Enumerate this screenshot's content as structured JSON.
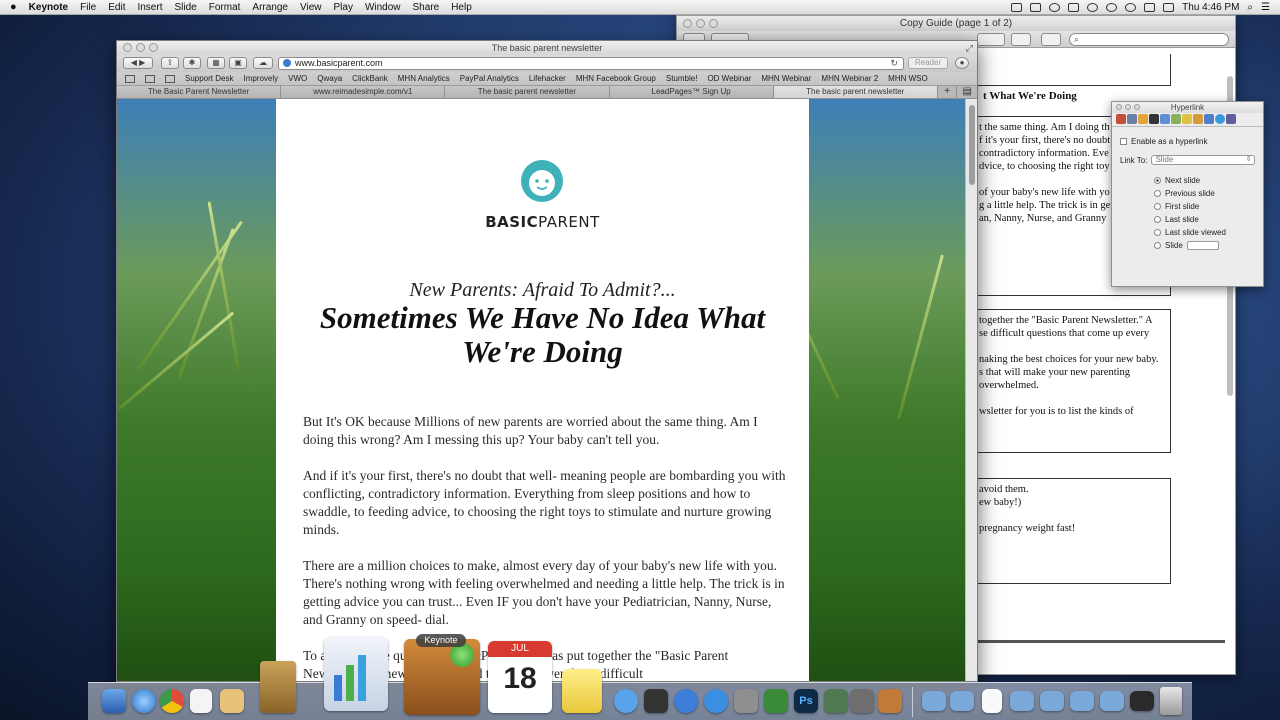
{
  "menubar": {
    "apple": "",
    "app_name": "Keynote",
    "items": [
      "File",
      "Edit",
      "Insert",
      "Slide",
      "Format",
      "Arrange",
      "View",
      "Play",
      "Window",
      "Share",
      "Help"
    ],
    "clock": "Thu 4:46 PM",
    "search_glyph": "⌕",
    "list_glyph": "☰"
  },
  "copy_guide": {
    "title": "Copy Guide (page 1 of 2)",
    "search_placeholder": "",
    "heading_fragment": "t What We're Doing",
    "box1_lines": [
      "t the same thing. Am I doing th",
      "f it's your first, there's no doubt",
      "contradictory information. Eve",
      "dvice, to choosing the right toy",
      "",
      "of your baby's new life with yo",
      "g a little help. The trick is in get",
      "an, Nanny, Nurse, and Granny"
    ],
    "box2_lines": [
      "together the \"Basic Parent Newsletter.\" A",
      "se difficult questions that come up every",
      "",
      "naking the best choices for your new baby.",
      "s that will make your new parenting",
      "overwhelmed.",
      "",
      "wsletter for you is to list the kinds of"
    ],
    "box3_lines": [
      "avoid them.",
      "ew baby!)",
      "",
      " pregnancy weight fast!"
    ]
  },
  "hyperlink": {
    "title": "Hyperlink",
    "enable_label": "Enable as a hyperlink",
    "link_to_label": "Link To:",
    "link_to_value": "Slide",
    "options": [
      "Next slide",
      "Previous slide",
      "First slide",
      "Last slide",
      "Last slide viewed",
      "Slide"
    ],
    "selected_option": 0
  },
  "safari": {
    "title": "The basic parent newsletter",
    "url": "www.basicparent.com",
    "reader_label": "Reader",
    "bookmarks": [
      "Support Desk",
      "Improvely",
      "VWO",
      "Qwaya",
      "ClickBank",
      "MHN Analytics",
      "PayPal Analytics",
      "Lifehacker",
      "MHN Facebook Group",
      "Stumble!",
      "OD Webinar",
      "MHN Webinar",
      "MHN Webinar 2",
      "MHN WSO"
    ],
    "tabs": [
      {
        "label": "The Basic Parent Newsletter",
        "active": false
      },
      {
        "label": "www.reimadesimple.com/v1",
        "active": false
      },
      {
        "label": "The basic parent newsletter",
        "active": false
      },
      {
        "label": "LeadPages™ Sign Up",
        "active": false
      },
      {
        "label": "The basic parent newsletter",
        "active": true
      }
    ],
    "new_tab": "+"
  },
  "page": {
    "brand_bold": "BASIC",
    "brand_light": "PARENT",
    "kicker": "New Parents: Afraid To Admit?...",
    "headline": "Sometimes We Have No Idea What We're Doing",
    "paragraphs": [
      "But It's OK because Millions of new parents are worried about the same thing. Am I doing this wrong? Am I messing this up? Your baby can't tell you.",
      "And if it's your first, there's no doubt that well- meaning people are bombarding you with conflicting, contradictory information. Everything from sleep positions and how to swaddle, to feeding advice, to choosing the right toys to stimulate and nurture growing minds.",
      "There are a million choices to make, almost every day of your baby's new life with you. There's nothing wrong with feeling overwhelmed and needing a little help. The trick is in getting advice you can trust... Even IF you don't have your Pediatrician, Nanny, Nurse, and Granny on speed- dial.",
      "To answer these questions, BasicParent.com has put together the \"Basic Parent Newsletter.\" A newsletter created to help answer those difficult"
    ]
  },
  "dock": {
    "tooltip": "Keynote",
    "calendar_month": "JUL",
    "calendar_day": "18",
    "photoshop_label": "Ps"
  },
  "colors": {
    "brand_teal": "#3fb1b8",
    "sky_blue": "#3e7fb7",
    "grass_green": "#3f7a2a"
  }
}
